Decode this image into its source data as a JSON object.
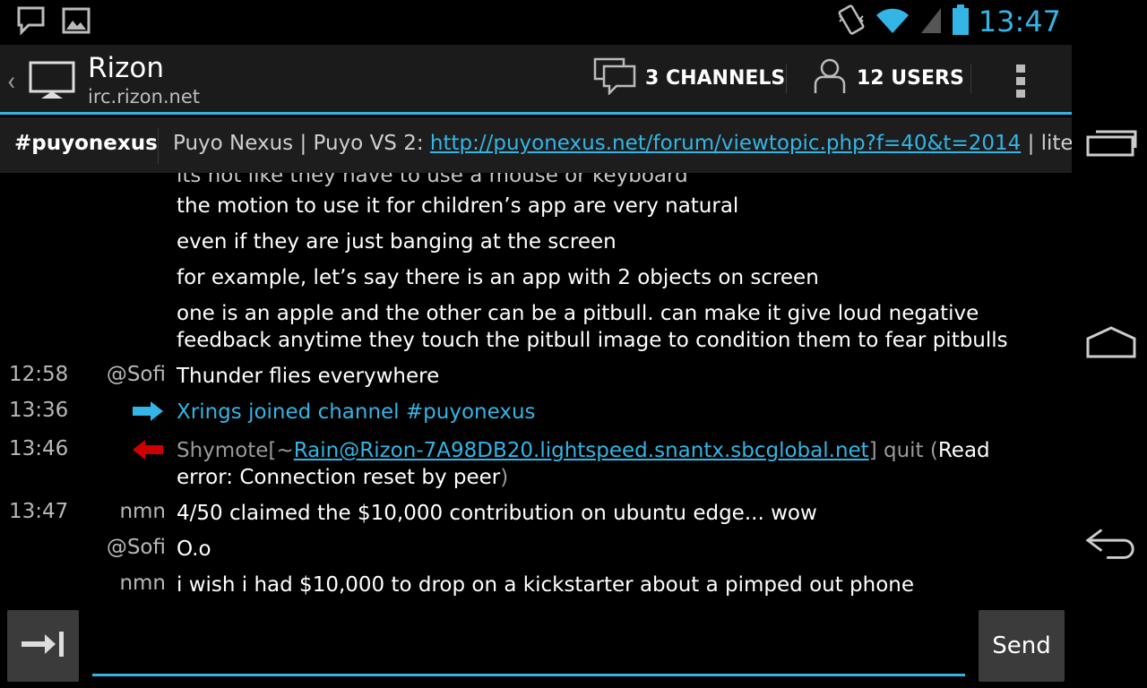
{
  "status_bar": {
    "time": "13:47",
    "notification_icons": [
      "chat-notification-icon",
      "image-notification-icon"
    ],
    "system_icons": [
      "vibrate-icon",
      "wifi-icon",
      "signal-icon",
      "battery-icon"
    ]
  },
  "action_bar": {
    "title": "Rizon",
    "subtitle": "irc.rizon.net",
    "channels_label": "3 CHANNELS",
    "users_label": "12 USERS"
  },
  "topic_bar": {
    "channel": "#puyonexus",
    "topic_prefix": "Puyo Nexus | Puyo VS 2: ",
    "topic_link": "http://puyonexus.net/forum/viewtopic.php?f=40&t=2014",
    "topic_suffix": " | lite"
  },
  "messages": {
    "partial_top": "its not like they have to use a mouse or keyboard",
    "items": [
      {
        "time": "",
        "nick": "",
        "text": "the motion to use it for children’s app are very natural"
      },
      {
        "time": "",
        "nick": "",
        "text": "even if they are just banging at the screen"
      },
      {
        "time": "",
        "nick": "",
        "text": "for example, let’s say there is an app with 2 objects on screen"
      },
      {
        "time": "",
        "nick": "",
        "text": "one is an apple and the other can be a pitbull. can make it give loud negative feedback anytime they touch the pitbull image to condition them to fear pitbulls"
      },
      {
        "time": "12:58",
        "nick": "@Sofi",
        "text": "Thunder flies everywhere"
      },
      {
        "time": "13:36",
        "nick": "",
        "text_a": "Xrings joined channel ",
        "text_b": "#puyonexus"
      },
      {
        "time": "13:46",
        "nick": "",
        "text_a": "Shymote[~",
        "link": "Rain@Rizon-7A98DB20.lightspeed.snantx.sbcglobal.net",
        "text_b": "] quit (",
        "text_c": "Read error: Connection reset by peer",
        "text_d": ")"
      },
      {
        "time": "13:47",
        "nick": "nmn",
        "text": "4/50 claimed the $10,000 contribution on ubuntu edge... wow"
      },
      {
        "time": "",
        "nick": "@Sofi",
        "text": "O.o"
      },
      {
        "time": "",
        "nick": "nmn",
        "text": "i wish i had $10,000 to drop on a kickstarter about a pimped out phone"
      }
    ]
  },
  "input_bar": {
    "input_value": "",
    "send_label": "Send"
  },
  "colors": {
    "accent": "#33b5e5",
    "join_arrow": "#33b5e5",
    "quit_arrow": "#cc0000"
  }
}
